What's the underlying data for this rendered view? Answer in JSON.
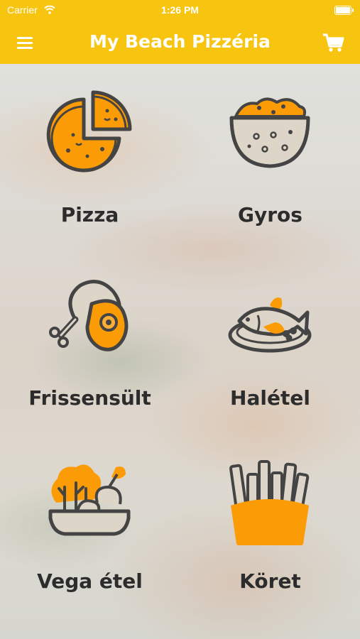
{
  "status_bar": {
    "carrier": "Carrier",
    "time": "1:26 PM"
  },
  "header": {
    "title": "My Beach Pizzéria"
  },
  "icons": {
    "menu": "hamburger-menu-icon",
    "cart": "shopping-cart-icon",
    "wifi": "wifi-icon",
    "battery": "battery-icon"
  },
  "colors": {
    "accent": "#f7c40f",
    "icon_fill": "#fb9b06",
    "icon_stroke": "#444444",
    "label": "#2c2c2c"
  },
  "categories": [
    {
      "label": "Pizza",
      "icon": "pizza-icon"
    },
    {
      "label": "Gyros",
      "icon": "gyros-bowl-icon"
    },
    {
      "label": "Frissensült",
      "icon": "chicken-leg-steak-icon"
    },
    {
      "label": "Halétel",
      "icon": "fish-plate-icon"
    },
    {
      "label": "Vega étel",
      "icon": "vegetable-bowl-icon"
    },
    {
      "label": "Köret",
      "icon": "french-fries-icon"
    }
  ]
}
